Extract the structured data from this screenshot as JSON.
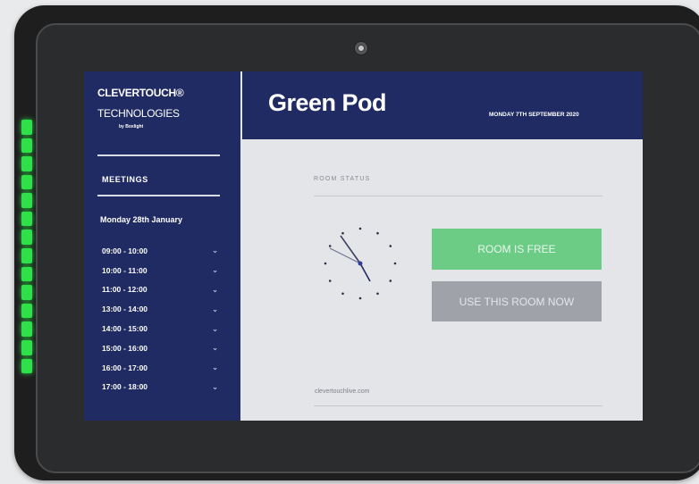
{
  "brand": {
    "line1": "CLEVERTOUCH®",
    "line2": "TECHNOLOGIES",
    "line3": "by Boxlight"
  },
  "sidebar": {
    "section_title": "MEETINGS",
    "date": "Monday 28th January",
    "slots": [
      {
        "time": "09:00 - 10:00"
      },
      {
        "time": "10:00 - 11:00"
      },
      {
        "time": "11:00 - 12:00"
      },
      {
        "time": "13:00 - 14:00"
      },
      {
        "time": "14:00 - 15:00"
      },
      {
        "time": "15:00 - 16:00"
      },
      {
        "time": "16:00 - 17:00"
      },
      {
        "time": "17:00 - 18:00"
      }
    ],
    "expand_icon": "chevron-down-icon"
  },
  "header": {
    "room_name": "Green Pod",
    "date": "MONDAY 7TH SEPTEMBER 2020"
  },
  "main": {
    "status_label": "ROOM STATUS",
    "free_button": "ROOM IS FREE",
    "use_button": "USE THIS ROOM NOW",
    "footer_url": "clevertouchlive.com",
    "clock_icon": "analog-clock-icon"
  },
  "colors": {
    "navy": "#1f2b62",
    "free_green": "#6ccc86",
    "use_grey": "#9fa2a8",
    "led_green": "#2fe04b"
  }
}
